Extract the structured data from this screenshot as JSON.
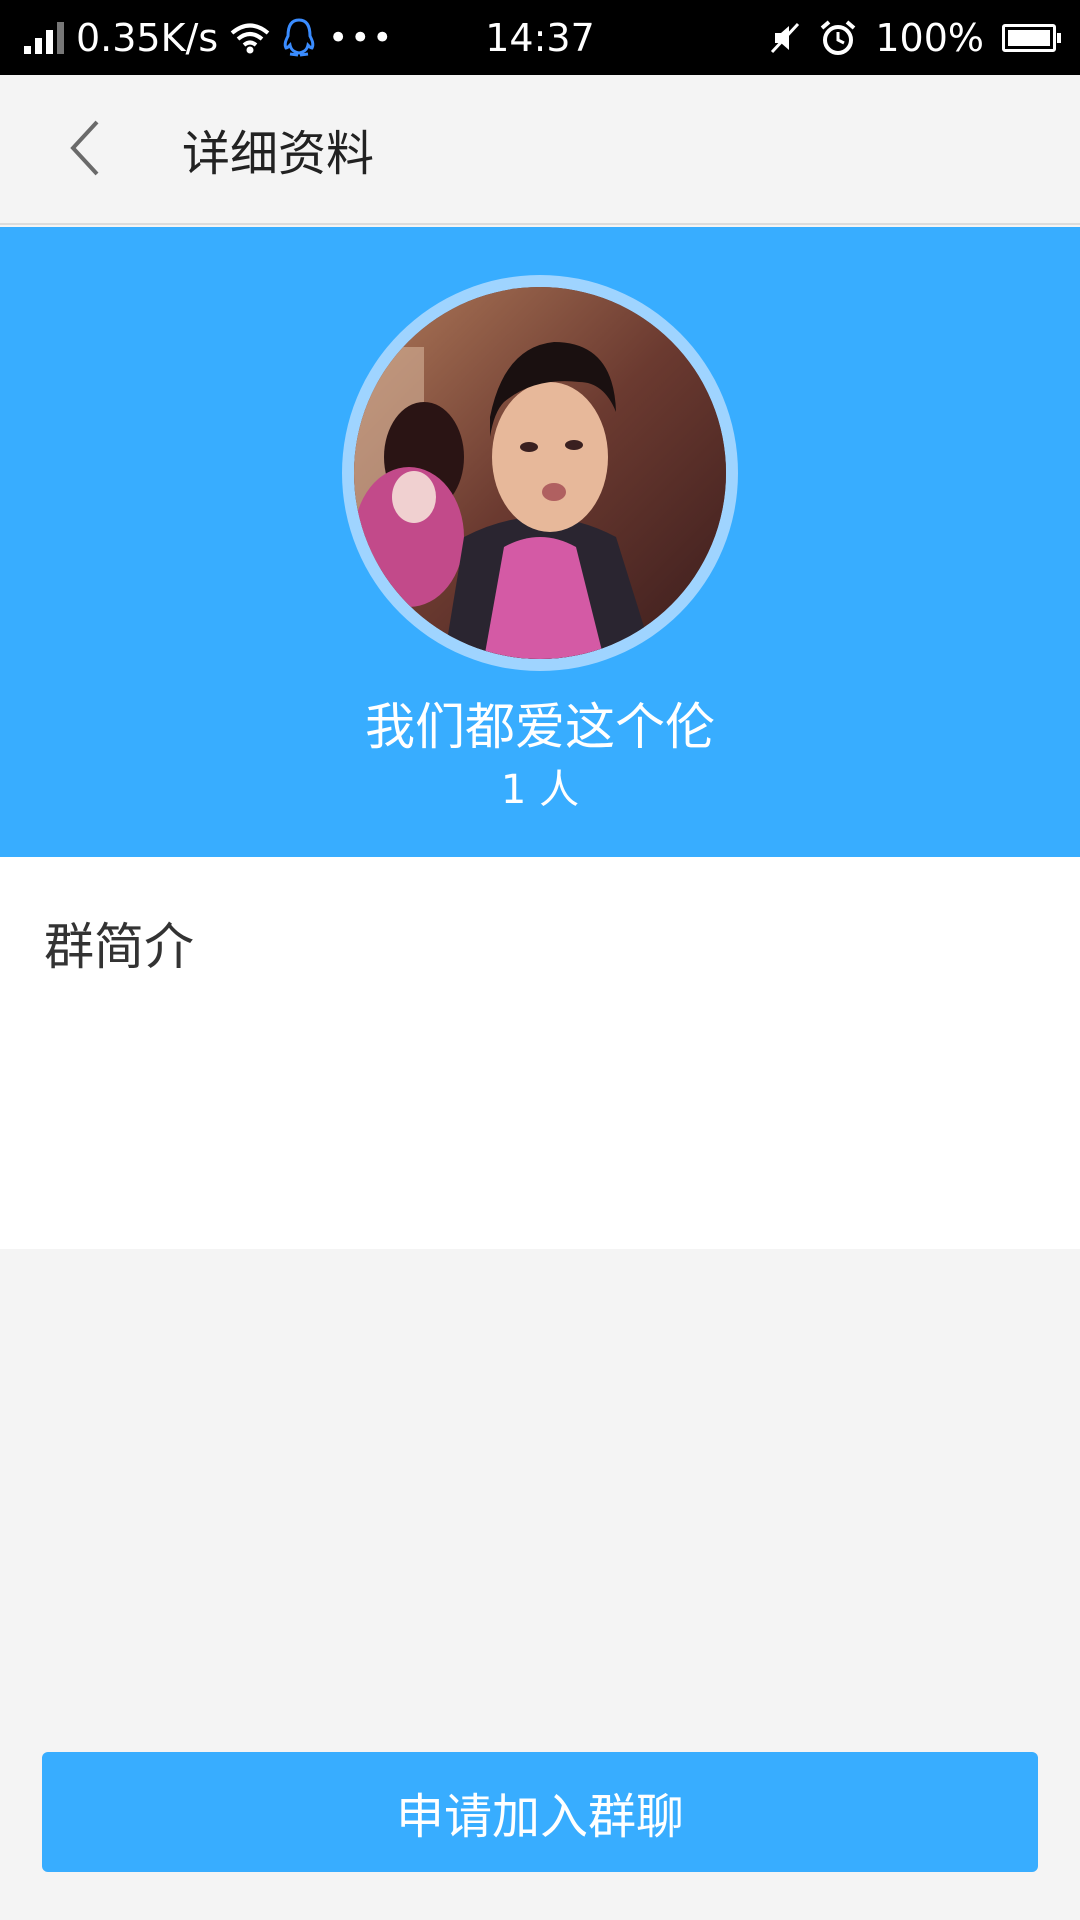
{
  "status_bar": {
    "net_speed": "0.35K/s",
    "more": "•••",
    "time": "14:37",
    "battery": "100%",
    "battery_level": 1.0
  },
  "header": {
    "back_icon": "chevron-left-icon",
    "title": "详细资料"
  },
  "profile": {
    "avatar": "group-avatar-photo",
    "name": "我们都爱这个伦",
    "member_count": "1 人"
  },
  "intro": {
    "label": "群简介"
  },
  "actions": {
    "join_label": "申请加入群聊"
  },
  "colors": {
    "accent": "#38adff",
    "ring": "#9fd4ff",
    "background": "#f4f4f4"
  }
}
